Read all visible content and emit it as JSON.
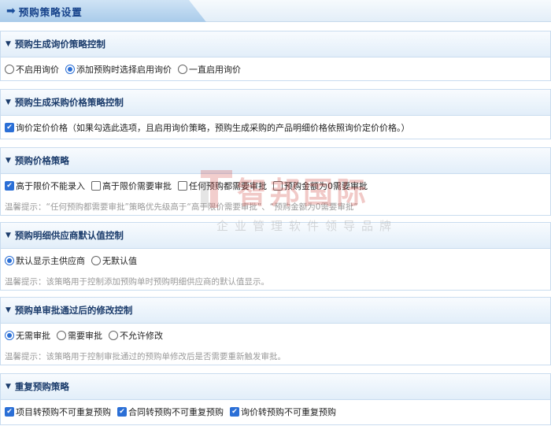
{
  "page": {
    "title": "预购策略设置"
  },
  "icons": {
    "title": "arrow-right-icon",
    "section": "caret-down-icon",
    "check": "checkmark-icon"
  },
  "colors": {
    "accent": "#2b6fd6",
    "heading": "#1a3b6b",
    "hint": "#9a9a9a",
    "watermark": "#cd3c37"
  },
  "sections": [
    {
      "title": "预购生成询价策略控制",
      "options": [
        {
          "type": "radio",
          "label": "不启用询价",
          "checked": false
        },
        {
          "type": "radio",
          "label": "添加预购时选择启用询价",
          "checked": true
        },
        {
          "type": "radio",
          "label": "一直启用询价",
          "checked": false
        }
      ]
    },
    {
      "title": "预购生成采购价格策略控制",
      "options": [
        {
          "type": "checkbox",
          "label": "询价定价价格（如果勾选此选项，且启用询价策略，预购生成采购的产品明细价格依照询价定价价格。）",
          "checked": true
        }
      ]
    },
    {
      "title": "预购价格策略",
      "options": [
        {
          "type": "checkbox",
          "label": "高于限价不能录入",
          "checked": true
        },
        {
          "type": "checkbox",
          "label": "高于限价需要审批",
          "checked": false
        },
        {
          "type": "checkbox",
          "label": "任何预购都需要审批",
          "checked": false
        },
        {
          "type": "checkbox",
          "label": "预购金额为0需要审批",
          "checked": false
        }
      ],
      "hint": "温馨提示：“任何预购都需要审批”策略优先级高于“高于限价需要审批”、“预购金额为0需要审批”"
    },
    {
      "title": "预购明细供应商默认值控制",
      "options": [
        {
          "type": "radio",
          "label": "默认显示主供应商",
          "checked": true
        },
        {
          "type": "radio",
          "label": "无默认值",
          "checked": false
        }
      ],
      "hint": "温馨提示：该策略用于控制添加预购单时预购明细供应商的默认值显示。"
    },
    {
      "title": "预购单审批通过后的修改控制",
      "options": [
        {
          "type": "radio",
          "label": "无需审批",
          "checked": true
        },
        {
          "type": "radio",
          "label": "需要审批",
          "checked": false
        },
        {
          "type": "radio",
          "label": "不允许修改",
          "checked": false
        }
      ],
      "hint": "温馨提示：该策略用于控制审批通过的预购单修改后是否需要重新触发审批。"
    },
    {
      "title": "重复预购策略",
      "options": [
        {
          "type": "checkbox",
          "label": "项目转预购不可重复预购",
          "checked": true
        },
        {
          "type": "checkbox",
          "label": "合同转预购不可重复预购",
          "checked": true
        },
        {
          "type": "checkbox",
          "label": "询价转预购不可重复预购",
          "checked": true
        }
      ]
    }
  ],
  "watermark": {
    "brand": "智邦国际",
    "slogan": "企业管理软件领导品牌"
  }
}
